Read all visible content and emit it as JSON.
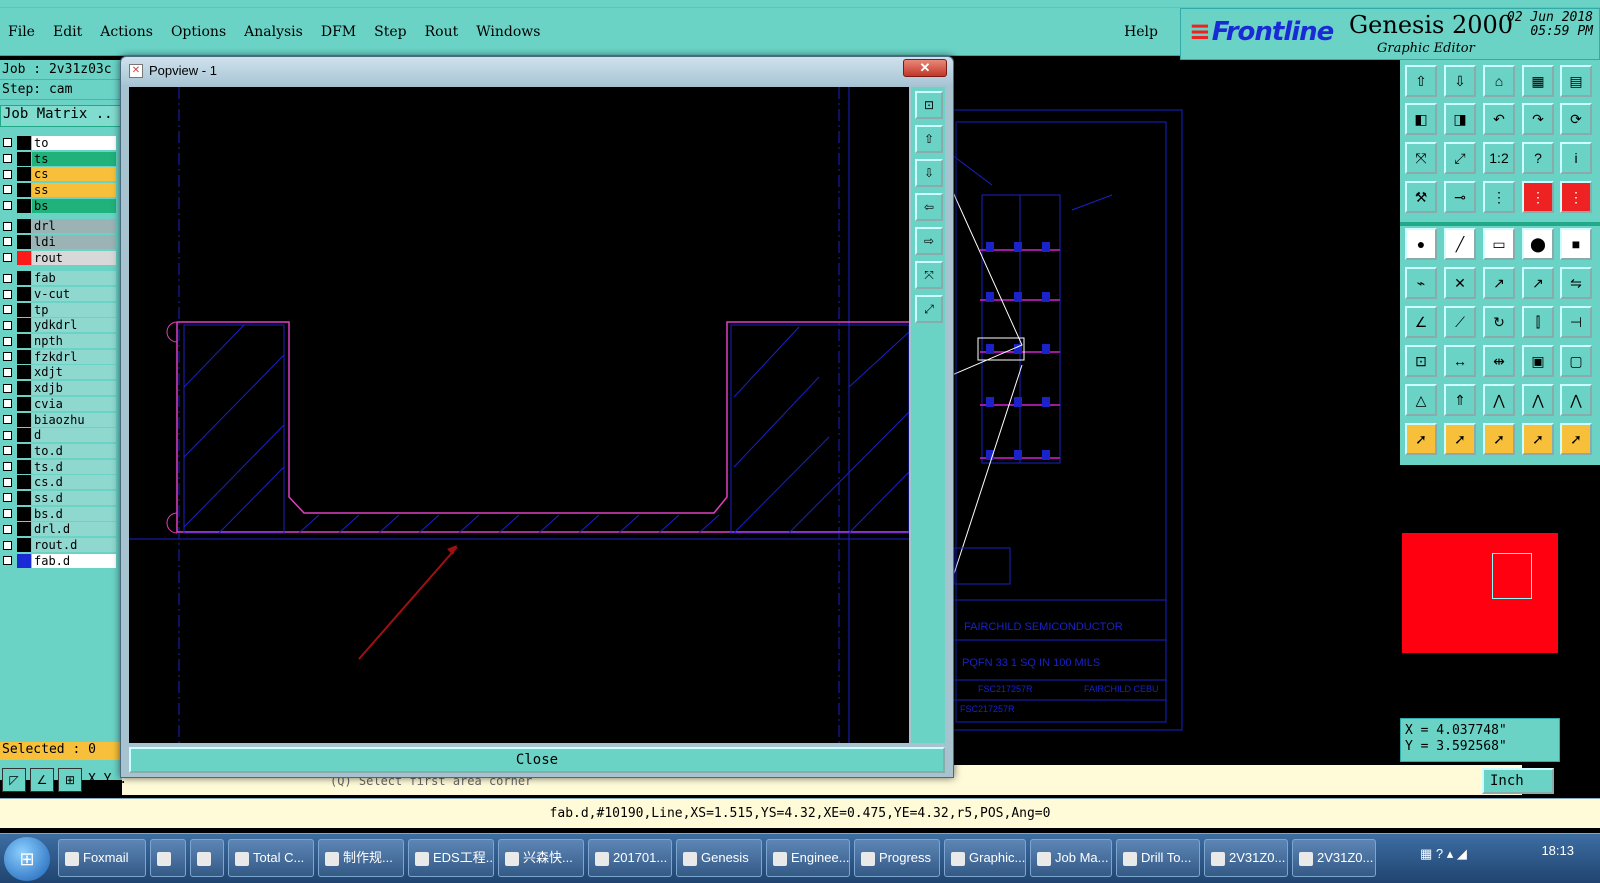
{
  "menu": {
    "items": [
      "File",
      "Edit",
      "Actions",
      "Options",
      "Analysis",
      "DFM",
      "Step",
      "Rout",
      "Windows"
    ],
    "help": "Help"
  },
  "brand": {
    "logo": "Frontline",
    "title": "Genesis 2000",
    "subtitle": "Graphic Editor",
    "date": "02 Jun 2018",
    "time": "05:59 PM"
  },
  "left": {
    "job": "Job : 2v31z03c",
    "step": "Step: cam",
    "job_matrix": "Job Matrix ..",
    "selected": "Selected : 0",
    "layers": [
      {
        "name": "to",
        "color": "#ffffff",
        "bg": "#ffffff",
        "swatch": "#000000"
      },
      {
        "name": "ts",
        "color": "#1fb27a",
        "bg": "#1fb27a",
        "swatch": "#000000"
      },
      {
        "name": "cs",
        "color": "#f8c03a",
        "bg": "#f8c03a",
        "swatch": "#000000"
      },
      {
        "name": "ss",
        "color": "#f8c03a",
        "bg": "#f8c03a",
        "swatch": "#000000"
      },
      {
        "name": "bs",
        "color": "#1fb27a",
        "bg": "#1fb27a",
        "swatch": "#000000"
      },
      {
        "name": "drl",
        "color": "#9bb3b5",
        "bg": "#9bb3b5",
        "swatch": "#000000"
      },
      {
        "name": "ldi",
        "color": "#9bb3b5",
        "bg": "#9bb3b5",
        "swatch": "#000000"
      },
      {
        "name": "rout",
        "color": "#d8d8d8",
        "bg": "#d8d8d8",
        "swatch": "#ff1a1a"
      },
      {
        "name": "fab",
        "color": "#8fd8cf",
        "bg": "#8fd8cf",
        "swatch": "#000000"
      },
      {
        "name": "v-cut",
        "color": "#8fd8cf",
        "bg": "#8fd8cf",
        "swatch": "#000000"
      },
      {
        "name": "tp",
        "color": "#8fd8cf",
        "bg": "#8fd8cf",
        "swatch": "#000000"
      },
      {
        "name": "ydkdrl",
        "color": "#8fd8cf",
        "bg": "#8fd8cf",
        "swatch": "#000000"
      },
      {
        "name": "npth",
        "color": "#8fd8cf",
        "bg": "#8fd8cf",
        "swatch": "#000000"
      },
      {
        "name": "fzkdrl",
        "color": "#8fd8cf",
        "bg": "#8fd8cf",
        "swatch": "#000000"
      },
      {
        "name": "xdjt",
        "color": "#8fd8cf",
        "bg": "#8fd8cf",
        "swatch": "#000000"
      },
      {
        "name": "xdjb",
        "color": "#8fd8cf",
        "bg": "#8fd8cf",
        "swatch": "#000000"
      },
      {
        "name": "cvia",
        "color": "#8fd8cf",
        "bg": "#8fd8cf",
        "swatch": "#000000"
      },
      {
        "name": "biaozhu",
        "color": "#8fd8cf",
        "bg": "#8fd8cf",
        "swatch": "#000000"
      },
      {
        "name": "d",
        "color": "#8fd8cf",
        "bg": "#8fd8cf",
        "swatch": "#000000"
      },
      {
        "name": "to.d",
        "color": "#8fd8cf",
        "bg": "#8fd8cf",
        "swatch": "#000000"
      },
      {
        "name": "ts.d",
        "color": "#8fd8cf",
        "bg": "#8fd8cf",
        "swatch": "#000000"
      },
      {
        "name": "cs.d",
        "color": "#8fd8cf",
        "bg": "#8fd8cf",
        "swatch": "#000000"
      },
      {
        "name": "ss.d",
        "color": "#8fd8cf",
        "bg": "#8fd8cf",
        "swatch": "#000000"
      },
      {
        "name": "bs.d",
        "color": "#8fd8cf",
        "bg": "#8fd8cf",
        "swatch": "#000000"
      },
      {
        "name": "drl.d",
        "color": "#8fd8cf",
        "bg": "#8fd8cf",
        "swatch": "#000000"
      },
      {
        "name": "rout.d",
        "color": "#8fd8cf",
        "bg": "#8fd8cf",
        "swatch": "#000000"
      },
      {
        "name": "fab.d",
        "color": "#ffffff",
        "bg": "#ffffff",
        "swatch": "#1a2bd6"
      }
    ]
  },
  "popview": {
    "title": "Popview - 1",
    "close_label": "Close"
  },
  "canvas_text": {
    "company": "FAIRCHILD SEMICONDUCTOR",
    "part": "PQFN 33 1 SQ IN 100 MILS",
    "code1": "FSC217257R",
    "code2": "FAIRCHILD CEBU",
    "code3": "FSC217257R"
  },
  "coords": {
    "x": "X = 4.037748\"",
    "y": "Y = 3.592568\""
  },
  "cmd": {
    "xy_label": "X Y :",
    "prompt": "(Q)   Select first area corner",
    "units": "Inch"
  },
  "status": "fab.d,#10190,Line,XS=1.515,YS=4.32,XE=0.475,YE=4.32,r5,POS,Ang=0",
  "taskbar": {
    "items": [
      "Foxmail",
      "",
      "",
      "Total C...",
      "制作规...",
      "EDS工程...",
      "兴森快...",
      "201701...",
      "Genesis",
      "Enginee...",
      "Progress",
      "Graphic...",
      "Job Ma...",
      "Drill To...",
      "2V31Z0...",
      "2V31Z0..."
    ],
    "clock": "18:13"
  }
}
